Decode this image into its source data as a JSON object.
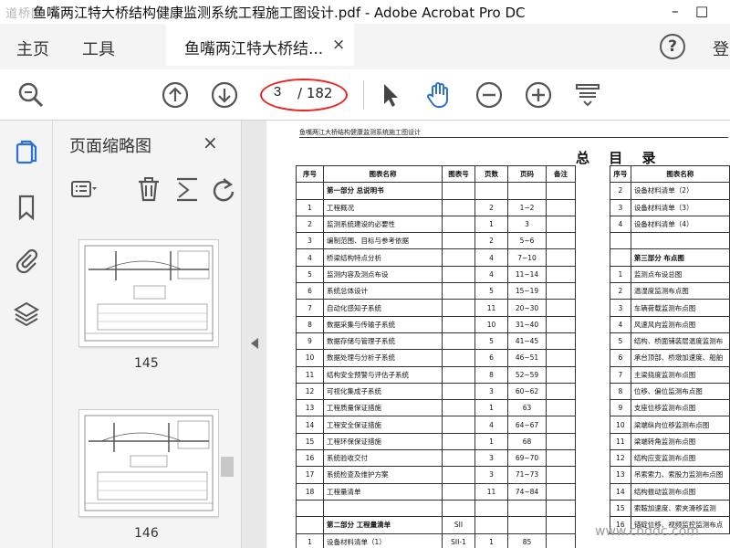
{
  "window": {
    "title": "鱼嘴两江特大桥结构健康监测系统工程施工图设计.pdf - Adobe Acrobat Pro DC",
    "watermark_top": "道桥网",
    "minimize_symbol": "–",
    "maximize_symbol": "□"
  },
  "menubar": {
    "home_label": "主页",
    "tools_label": "工具",
    "doc_tab_label": "鱼嘴两江特大桥结...",
    "doc_tab_close": "×",
    "help_symbol": "?",
    "signin_cut": "登"
  },
  "toolbar": {
    "current_page": "3",
    "total_pages": "/ 182",
    "annotation_color": "#e22222",
    "accent_color": "#2c6fd6"
  },
  "thumbnail_panel": {
    "title": "页面缩略图",
    "close": "×",
    "thumbnails": [
      {
        "page": "145"
      },
      {
        "page": "146"
      }
    ]
  },
  "document": {
    "header_text": "鱼嘴两江大桥结构健康监测系统施工图设计",
    "title": "总 目 录",
    "columns": [
      "序号",
      "图表名称",
      "图表号",
      "页数",
      "页码",
      "备注"
    ],
    "rows": [
      {
        "no": "",
        "name": "第一部分 总说明书",
        "code": "",
        "pages": "",
        "range": "",
        "bold": true
      },
      {
        "no": "1",
        "name": "工程概况",
        "code": "",
        "pages": "2",
        "range": "1~2"
      },
      {
        "no": "2",
        "name": "监测系统建设的必要性",
        "code": "",
        "pages": "1",
        "range": "3"
      },
      {
        "no": "3",
        "name": "编制范围、目标与参考依据",
        "code": "",
        "pages": "2",
        "range": "5~6"
      },
      {
        "no": "4",
        "name": "桥梁结构特点分析",
        "code": "",
        "pages": "4",
        "range": "7~10"
      },
      {
        "no": "5",
        "name": "监测内容及测点布设",
        "code": "",
        "pages": "4",
        "range": "11~14"
      },
      {
        "no": "6",
        "name": "系统总体设计",
        "code": "",
        "pages": "5",
        "range": "15~19"
      },
      {
        "no": "7",
        "name": "自动化感知子系统",
        "code": "",
        "pages": "11",
        "range": "20~30"
      },
      {
        "no": "8",
        "name": "数据采集与传输子系统",
        "code": "",
        "pages": "10",
        "range": "31~40"
      },
      {
        "no": "9",
        "name": "数据存储与管理子系统",
        "code": "",
        "pages": "5",
        "range": "41~45"
      },
      {
        "no": "10",
        "name": "数据处理与分析子系统",
        "code": "",
        "pages": "6",
        "range": "46~51"
      },
      {
        "no": "11",
        "name": "结构安全预警与评估子系统",
        "code": "",
        "pages": "8",
        "range": "52~59"
      },
      {
        "no": "12",
        "name": "可视化集成子系统",
        "code": "",
        "pages": "3",
        "range": "60~62"
      },
      {
        "no": "13",
        "name": "工程质量保证措施",
        "code": "",
        "pages": "1",
        "range": "63"
      },
      {
        "no": "14",
        "name": "工程安全保证措施",
        "code": "",
        "pages": "4",
        "range": "64~67"
      },
      {
        "no": "15",
        "name": "工程环保保证措施",
        "code": "",
        "pages": "1",
        "range": "68"
      },
      {
        "no": "16",
        "name": "系统验收交付",
        "code": "",
        "pages": "3",
        "range": "69~70"
      },
      {
        "no": "17",
        "name": "系统检查及维护方案",
        "code": "",
        "pages": "3",
        "range": "71~73"
      },
      {
        "no": "18",
        "name": "工程量清单",
        "code": "",
        "pages": "11",
        "range": "74~84"
      },
      {
        "no": "",
        "name": "",
        "code": "",
        "pages": "",
        "range": ""
      },
      {
        "no": "",
        "name": "第二部分 工程量清单",
        "code": "SII",
        "pages": "",
        "range": "",
        "bold": true
      },
      {
        "no": "1",
        "name": "设备材料清单（1）",
        "code": "SII-1",
        "pages": "1",
        "range": "85"
      }
    ],
    "right_columns": [
      "序号",
      "图表名称"
    ],
    "right_rows": [
      {
        "no": "2",
        "name": "设备材料清单（2）"
      },
      {
        "no": "3",
        "name": "设备材料清单（3）"
      },
      {
        "no": "4",
        "name": "设备材料清单（4）"
      },
      {
        "no": "",
        "name": ""
      },
      {
        "no": "",
        "name": "第三部分 布点图",
        "bold": true
      },
      {
        "no": "1",
        "name": "监测点布设总图"
      },
      {
        "no": "2",
        "name": "温湿度监测布点图"
      },
      {
        "no": "3",
        "name": "车辆荷载监测布点图"
      },
      {
        "no": "4",
        "name": "风速风向监测布点图"
      },
      {
        "no": "5",
        "name": "结构、桥面铺装层温度监测布"
      },
      {
        "no": "6",
        "name": "承台顶部、桥墩加速度、船舶"
      },
      {
        "no": "7",
        "name": "主梁挠度监测布点图"
      },
      {
        "no": "8",
        "name": "位移、偏位监测布点图"
      },
      {
        "no": "9",
        "name": "支座位移监测布点图"
      },
      {
        "no": "10",
        "name": "梁端纵向位移监测布点图"
      },
      {
        "no": "11",
        "name": "梁端转角监测布点图"
      },
      {
        "no": "12",
        "name": "结构应变监测布点图"
      },
      {
        "no": "13",
        "name": "吊索索力、索股力监测布点图"
      },
      {
        "no": "14",
        "name": "结构振动监测布点图"
      },
      {
        "no": "15",
        "name": "索鞍加速度、索夹滑移监测"
      },
      {
        "no": "16",
        "name": "锚碇位移、视频监控监测布点"
      }
    ],
    "watermark_bottom": "www.cnddc.com"
  }
}
